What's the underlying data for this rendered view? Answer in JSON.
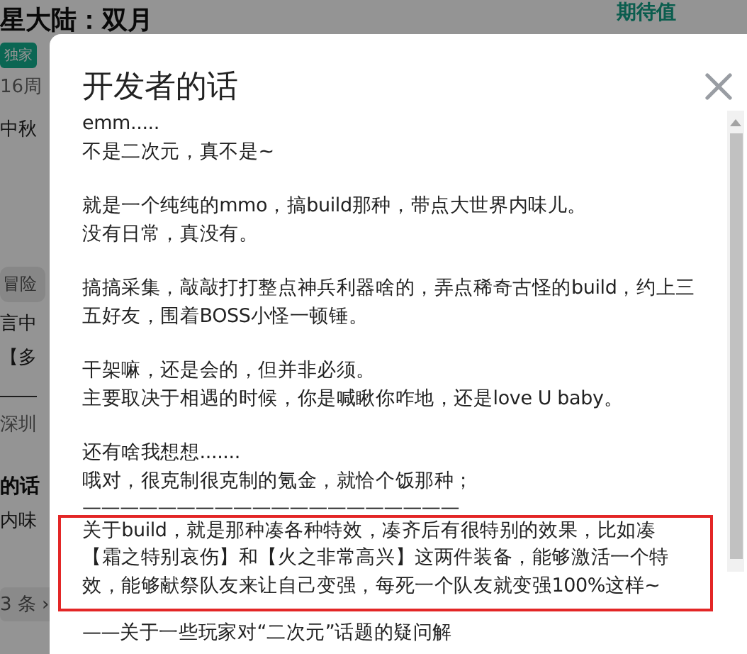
{
  "background": {
    "title": "星大陆：双月",
    "rating_label": "期待值",
    "tag": "独家",
    "age": "16周",
    "event": "中秋",
    "genre": "冒险",
    "text_1": "言中",
    "text_2": "【多",
    "author": "深圳",
    "section_title": "的话",
    "snippet": "内味",
    "more": "3 条 ›"
  },
  "dialog": {
    "title": "开发者的话",
    "paragraphs": [
      {
        "lines": [
          "emm.....",
          "不是二次元，真不是~"
        ],
        "highlighted": false
      },
      {
        "lines": [
          "就是一个纯纯的mmo，搞build那种，带点大世界内味儿。",
          "没有日常，真没有。"
        ],
        "highlighted": false
      },
      {
        "lines": [
          "搞搞采集，敲敲打打整点神兵利器啥的，弄点稀奇古怪的build，约上三五好友，围着BOSS小怪一顿锤。"
        ],
        "highlighted": false
      },
      {
        "lines": [
          "干架嘛，还是会的，但并非必须。",
          "主要取决于相遇的时候，你是喊瞅你咋地，还是love U baby。"
        ],
        "highlighted": false
      },
      {
        "lines": [
          "还有啥我想想.......",
          "哦对，很克制很克制的氪金，就恰个饭那种；",
          "————————————————————"
        ],
        "highlighted": false
      },
      {
        "lines": [
          "关于build，就是那种凑各种特效，凑齐后有很特别的效果，比如凑【霜之特别哀伤】和【火之非常高兴】这两件装备，能够激活一个特效，能够献祭队友来让自己变强，每死一个队友就变强100%这样~"
        ],
        "highlighted": true
      },
      {
        "lines": [
          "——关于一些玩家对“二次元”话题的疑问解"
        ],
        "highlighted": false
      }
    ]
  }
}
